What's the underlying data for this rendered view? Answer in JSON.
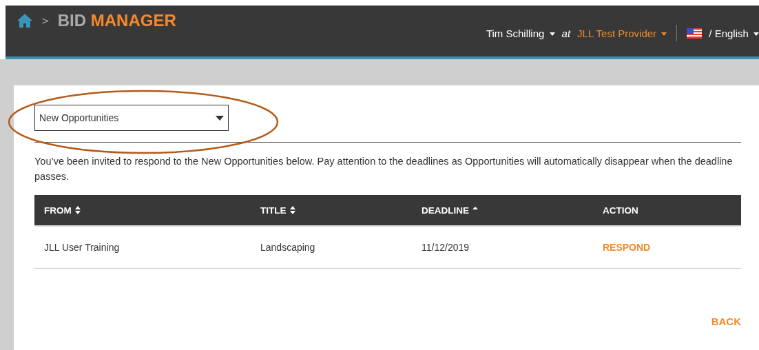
{
  "header": {
    "breadcrumb_separator": ">",
    "app_title": {
      "part_1": "BID",
      "part_2": "MANAGER"
    },
    "user": "Tim Schilling",
    "at": "at",
    "provider": "JLL Test Provider",
    "language": "/ English"
  },
  "filter": {
    "value": "New Opportunities"
  },
  "intro": "You’ve been invited to respond to the New Opportunities below. Pay attention to the deadlines as Opportunities will automatically disappear when the deadline passes.",
  "table": {
    "columns": [
      {
        "label": "FROM",
        "sortable": true,
        "sorted": false
      },
      {
        "label": "TITLE",
        "sortable": true,
        "sorted": false
      },
      {
        "label": "DEADLINE",
        "sortable": true,
        "sorted": true
      },
      {
        "label": "ACTION",
        "sortable": false,
        "sorted": false
      }
    ],
    "rows": [
      {
        "from": "JLL User Training",
        "title": "Landscaping",
        "deadline": "11/12/2019",
        "action": "RESPOND"
      }
    ]
  },
  "back": "BACK"
}
